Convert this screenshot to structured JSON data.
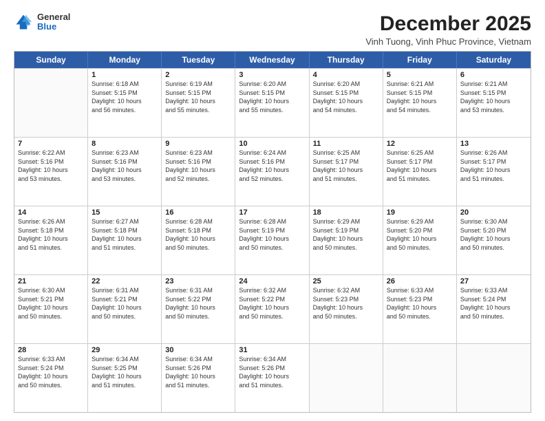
{
  "header": {
    "logo": {
      "general": "General",
      "blue": "Blue"
    },
    "title": "December 2025",
    "subtitle": "Vinh Tuong, Vinh Phuc Province, Vietnam"
  },
  "calendar": {
    "days_of_week": [
      "Sunday",
      "Monday",
      "Tuesday",
      "Wednesday",
      "Thursday",
      "Friday",
      "Saturday"
    ],
    "weeks": [
      [
        {
          "day": "",
          "info": ""
        },
        {
          "day": "1",
          "info": "Sunrise: 6:18 AM\nSunset: 5:15 PM\nDaylight: 10 hours\nand 56 minutes."
        },
        {
          "day": "2",
          "info": "Sunrise: 6:19 AM\nSunset: 5:15 PM\nDaylight: 10 hours\nand 55 minutes."
        },
        {
          "day": "3",
          "info": "Sunrise: 6:20 AM\nSunset: 5:15 PM\nDaylight: 10 hours\nand 55 minutes."
        },
        {
          "day": "4",
          "info": "Sunrise: 6:20 AM\nSunset: 5:15 PM\nDaylight: 10 hours\nand 54 minutes."
        },
        {
          "day": "5",
          "info": "Sunrise: 6:21 AM\nSunset: 5:15 PM\nDaylight: 10 hours\nand 54 minutes."
        },
        {
          "day": "6",
          "info": "Sunrise: 6:21 AM\nSunset: 5:15 PM\nDaylight: 10 hours\nand 53 minutes."
        }
      ],
      [
        {
          "day": "7",
          "info": "Sunrise: 6:22 AM\nSunset: 5:16 PM\nDaylight: 10 hours\nand 53 minutes."
        },
        {
          "day": "8",
          "info": "Sunrise: 6:23 AM\nSunset: 5:16 PM\nDaylight: 10 hours\nand 53 minutes."
        },
        {
          "day": "9",
          "info": "Sunrise: 6:23 AM\nSunset: 5:16 PM\nDaylight: 10 hours\nand 52 minutes."
        },
        {
          "day": "10",
          "info": "Sunrise: 6:24 AM\nSunset: 5:16 PM\nDaylight: 10 hours\nand 52 minutes."
        },
        {
          "day": "11",
          "info": "Sunrise: 6:25 AM\nSunset: 5:17 PM\nDaylight: 10 hours\nand 51 minutes."
        },
        {
          "day": "12",
          "info": "Sunrise: 6:25 AM\nSunset: 5:17 PM\nDaylight: 10 hours\nand 51 minutes."
        },
        {
          "day": "13",
          "info": "Sunrise: 6:26 AM\nSunset: 5:17 PM\nDaylight: 10 hours\nand 51 minutes."
        }
      ],
      [
        {
          "day": "14",
          "info": "Sunrise: 6:26 AM\nSunset: 5:18 PM\nDaylight: 10 hours\nand 51 minutes."
        },
        {
          "day": "15",
          "info": "Sunrise: 6:27 AM\nSunset: 5:18 PM\nDaylight: 10 hours\nand 51 minutes."
        },
        {
          "day": "16",
          "info": "Sunrise: 6:28 AM\nSunset: 5:18 PM\nDaylight: 10 hours\nand 50 minutes."
        },
        {
          "day": "17",
          "info": "Sunrise: 6:28 AM\nSunset: 5:19 PM\nDaylight: 10 hours\nand 50 minutes."
        },
        {
          "day": "18",
          "info": "Sunrise: 6:29 AM\nSunset: 5:19 PM\nDaylight: 10 hours\nand 50 minutes."
        },
        {
          "day": "19",
          "info": "Sunrise: 6:29 AM\nSunset: 5:20 PM\nDaylight: 10 hours\nand 50 minutes."
        },
        {
          "day": "20",
          "info": "Sunrise: 6:30 AM\nSunset: 5:20 PM\nDaylight: 10 hours\nand 50 minutes."
        }
      ],
      [
        {
          "day": "21",
          "info": "Sunrise: 6:30 AM\nSunset: 5:21 PM\nDaylight: 10 hours\nand 50 minutes."
        },
        {
          "day": "22",
          "info": "Sunrise: 6:31 AM\nSunset: 5:21 PM\nDaylight: 10 hours\nand 50 minutes."
        },
        {
          "day": "23",
          "info": "Sunrise: 6:31 AM\nSunset: 5:22 PM\nDaylight: 10 hours\nand 50 minutes."
        },
        {
          "day": "24",
          "info": "Sunrise: 6:32 AM\nSunset: 5:22 PM\nDaylight: 10 hours\nand 50 minutes."
        },
        {
          "day": "25",
          "info": "Sunrise: 6:32 AM\nSunset: 5:23 PM\nDaylight: 10 hours\nand 50 minutes."
        },
        {
          "day": "26",
          "info": "Sunrise: 6:33 AM\nSunset: 5:23 PM\nDaylight: 10 hours\nand 50 minutes."
        },
        {
          "day": "27",
          "info": "Sunrise: 6:33 AM\nSunset: 5:24 PM\nDaylight: 10 hours\nand 50 minutes."
        }
      ],
      [
        {
          "day": "28",
          "info": "Sunrise: 6:33 AM\nSunset: 5:24 PM\nDaylight: 10 hours\nand 50 minutes."
        },
        {
          "day": "29",
          "info": "Sunrise: 6:34 AM\nSunset: 5:25 PM\nDaylight: 10 hours\nand 51 minutes."
        },
        {
          "day": "30",
          "info": "Sunrise: 6:34 AM\nSunset: 5:26 PM\nDaylight: 10 hours\nand 51 minutes."
        },
        {
          "day": "31",
          "info": "Sunrise: 6:34 AM\nSunset: 5:26 PM\nDaylight: 10 hours\nand 51 minutes."
        },
        {
          "day": "",
          "info": ""
        },
        {
          "day": "",
          "info": ""
        },
        {
          "day": "",
          "info": ""
        }
      ]
    ]
  }
}
